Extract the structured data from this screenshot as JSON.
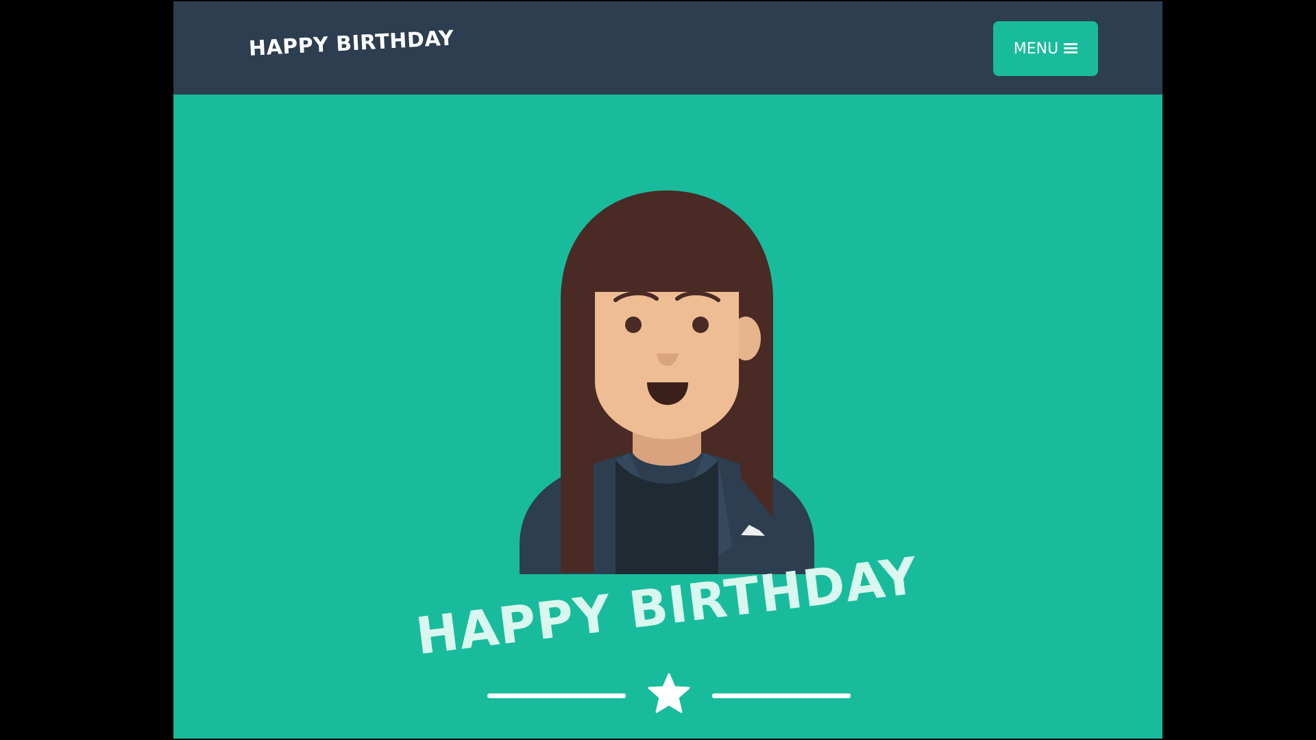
{
  "navbar": {
    "brand": "HAPPY BIRTHDAY",
    "menu_label": "MENU",
    "menu_icon": "hamburger-icon",
    "background": "#2c3e50"
  },
  "hero": {
    "background": "#18bc9c",
    "avatar": "woman-avatar-illustration",
    "heading": "HAPPY BIRTHDAY",
    "divider_icon": "star-icon"
  },
  "colors": {
    "accent": "#18bc9c",
    "navbar": "#2c3e50",
    "text": "#ffffff"
  }
}
